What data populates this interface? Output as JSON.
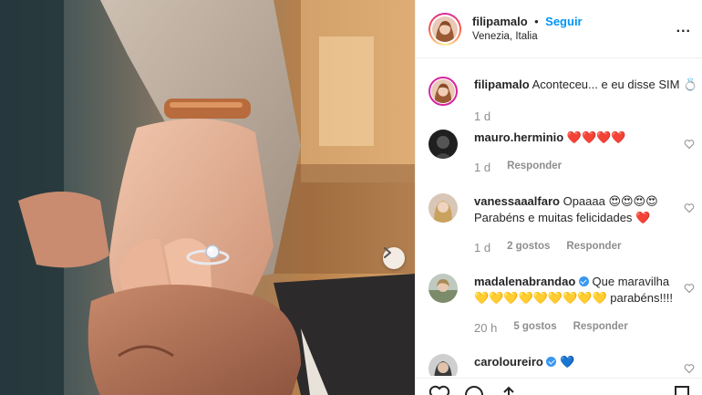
{
  "post": {
    "username": "filipamalo",
    "dot": "•",
    "follow_label": "Seguir",
    "location": "Venezia, Italia",
    "more_label": "...",
    "caption_user": "filipamalo",
    "caption_text": "Aconteceu... e eu disse SIM 💍",
    "caption_time": "1 d"
  },
  "comments": [
    {
      "user": "mauro.herminio",
      "text": "❤️❤️❤️❤️",
      "time": "1 d",
      "likes": "",
      "reply_label": "Responder"
    },
    {
      "user": "vanessaaalfaro",
      "text": "Opaaaa 😍😍😍😍 Parabéns e muitas felicidades ❤️",
      "time": "1 d",
      "likes": "2 gostos",
      "reply_label": "Responder"
    },
    {
      "user": "madalenabrandao",
      "text": "Que maravilha 💛💛💛💛💛💛💛💛💛 parabéns!!!!",
      "time": "20 h",
      "likes": "5 gostos",
      "reply_label": "Responder",
      "verified": true
    },
    {
      "user": "caroloureiro",
      "text": "💙",
      "verified": true
    }
  ],
  "colors": {
    "accent": "#0095f6",
    "muted": "#8e8e8e",
    "text": "#262626"
  },
  "icons": [
    "more-icon",
    "next-arrow-icon",
    "heart-outline-icon",
    "comment-icon",
    "share-icon",
    "bookmark-icon",
    "verified-icon"
  ]
}
